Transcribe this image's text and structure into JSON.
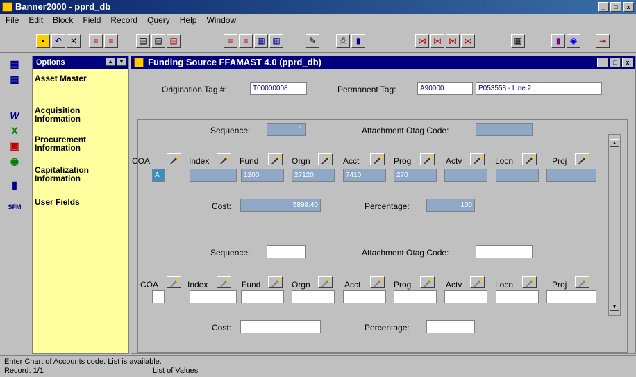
{
  "app": {
    "title": "Banner2000 - pprd_db",
    "min": "_",
    "max": "□",
    "close": "x"
  },
  "menu": [
    "File",
    "Edit",
    "Block",
    "Field",
    "Record",
    "Query",
    "Help",
    "Window"
  ],
  "toolbar": {
    "icons": [
      "save-icon",
      "rollback-icon",
      "exit-icon",
      "prev-block-icon",
      "next-block-icon",
      "print-icon",
      "save-form-icon",
      "print-form-icon",
      "insert-record-icon",
      "delete-record-icon",
      "next-record-icon",
      "prev-record-icon",
      "erase-icon",
      "printer-icon",
      "chart-icon",
      "query-icon",
      "enter-query-icon",
      "execute-query-icon",
      "cancel-query-icon",
      "calculator-icon",
      "color-icon",
      "exit-banner-icon"
    ]
  },
  "options_panel": {
    "title": "Options",
    "items": [
      {
        "label": "Asset Master"
      },
      {
        "label": "Acquisition Information"
      },
      {
        "label": "Procurement Information"
      },
      {
        "label": "Capitalization Information"
      },
      {
        "label": "User Fields"
      }
    ]
  },
  "form": {
    "title": "Funding Source  FFAMAST 4.0  (pprd_db)",
    "origination_tag_label": "Origination Tag #:",
    "origination_tag_value": "T00000008",
    "permanent_tag_label": "Permanent Tag:",
    "permanent_tag_value": "A90000",
    "permanent_tag_desc": "P053558 - Line 2",
    "record1": {
      "sequence_label": "Sequence:",
      "sequence_value": "1",
      "attachment_label": "Attachment Otag Code:",
      "attachment_value": "",
      "coa_label": "COA",
      "index_label": "Index",
      "fund_label": "Fund",
      "orgn_label": "Orgn",
      "acct_label": "Acct",
      "prog_label": "Prog",
      "actv_label": "Actv",
      "locn_label": "Locn",
      "proj_label": "Proj",
      "coa_value": "A",
      "index_value": "",
      "fund_value": "1200",
      "orgn_value": "27120",
      "acct_value": "7410",
      "prog_value": "270",
      "actv_value": "",
      "locn_value": "",
      "proj_value": "",
      "cost_label": "Cost:",
      "cost_value": "5898.40",
      "percentage_label": "Percentage:",
      "percentage_value": "100"
    },
    "record2": {
      "sequence_label": "Sequence:",
      "attachment_label": "Attachment Otag Code:",
      "coa_label": "COA",
      "index_label": "Index",
      "fund_label": "Fund",
      "orgn_label": "Orgn",
      "acct_label": "Acct",
      "prog_label": "Prog",
      "actv_label": "Actv",
      "locn_label": "Locn",
      "proj_label": "Proj",
      "cost_label": "Cost:",
      "percentage_label": "Percentage:"
    }
  },
  "status": {
    "message": "Enter Chart of Accounts code. List is available.",
    "record": "Record: 1/1",
    "lov": "List of Values"
  }
}
